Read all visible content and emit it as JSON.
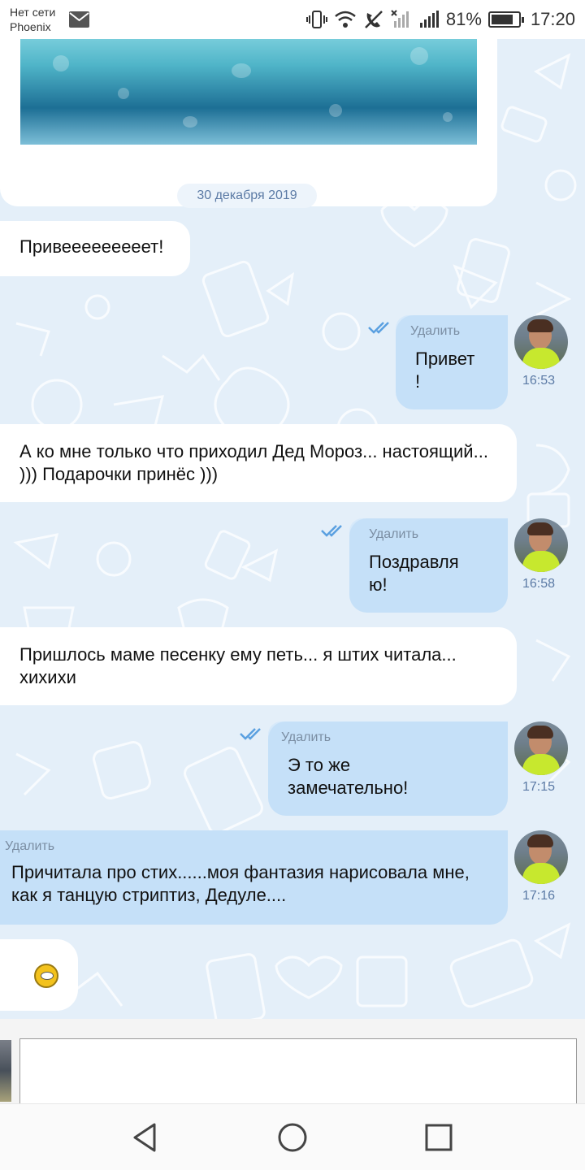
{
  "status_bar": {
    "carrier_line1": "Нет сети",
    "carrier_line2": "Phoenix",
    "battery": "81%",
    "battery_level": 0.81,
    "time": "17:20"
  },
  "chat": {
    "date_separator": "30 декабря 2019",
    "delete_label": "Удалить",
    "messages": [
      {
        "direction": "in",
        "text": "Привееееееееет!"
      },
      {
        "direction": "out",
        "text": "Привет\n!",
        "time": "16:53",
        "read": true
      },
      {
        "direction": "in",
        "text": "А ко мне только что приходил Дед Мороз... настоящий... ))) Подарочки принёс )))"
      },
      {
        "direction": "out",
        "text": "Поздравля\nю!",
        "time": "16:58",
        "read": true
      },
      {
        "direction": "in",
        "text": "Пришлось маме песенку ему петь... я штих читала... хихихи"
      },
      {
        "direction": "out",
        "text": "Э то же\nзамечательно!",
        "time": "17:15",
        "read": true
      },
      {
        "direction": "out",
        "text": "Причитала про стих......моя фантазия нарисовала мне, как я танцую стриптиз, Дедуле....",
        "time": "17:16",
        "read": false
      },
      {
        "direction": "in",
        "emoji": "smiling-face-emoji"
      }
    ]
  },
  "composer": {
    "value": "",
    "placeholder": ""
  },
  "colors": {
    "chat_background": "#e4eff9",
    "incoming_bubble": "#ffffff",
    "outgoing_bubble": "#c5e0f8",
    "timestamp": "#5b7aa5",
    "check_marks": "#5aa0e0"
  },
  "nav": {
    "back": "back-icon",
    "home": "home-icon",
    "recents": "recents-icon"
  }
}
